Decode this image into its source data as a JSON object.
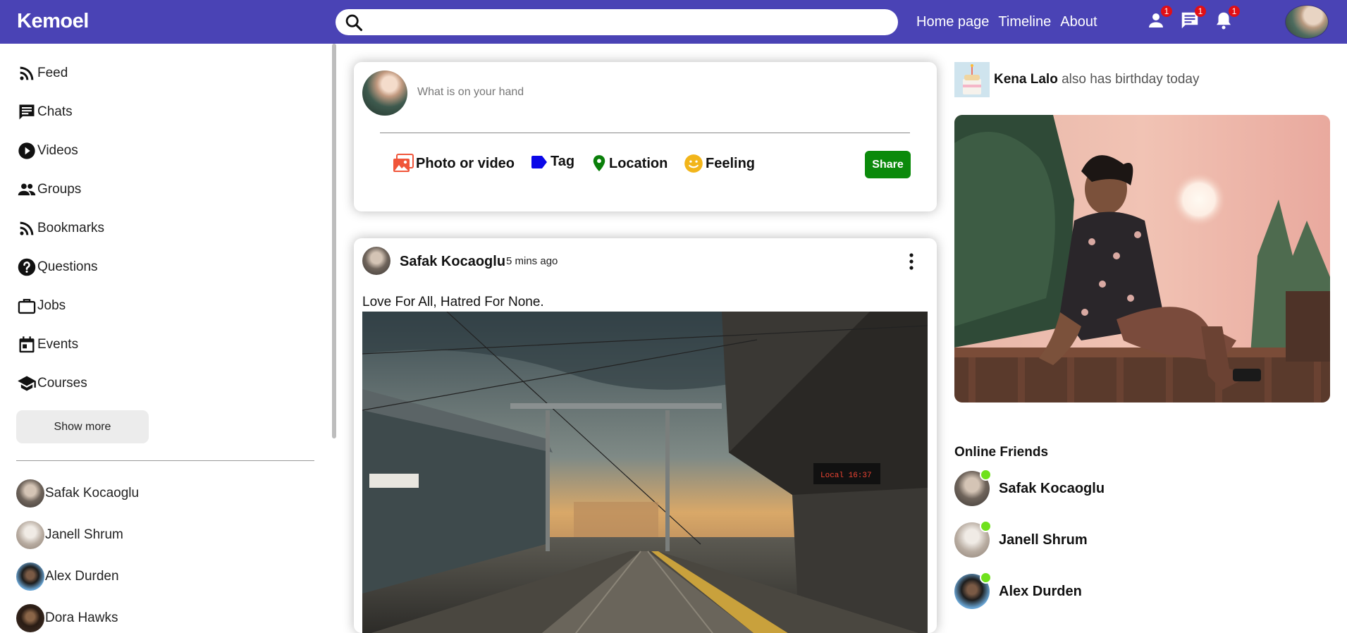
{
  "app": {
    "logo": "Kemoel"
  },
  "topbar": {
    "search_placeholder": "",
    "links": [
      "Home page",
      "Timeline",
      "About"
    ],
    "icons": [
      {
        "name": "person-icon",
        "badge": "1"
      },
      {
        "name": "chat-icon",
        "badge": "1"
      },
      {
        "name": "bell-icon",
        "badge": "1"
      }
    ]
  },
  "sidebar": {
    "items": [
      {
        "label": "Feed",
        "icon": "rss-icon"
      },
      {
        "label": "Chats",
        "icon": "chat-icon"
      },
      {
        "label": "Videos",
        "icon": "play-icon"
      },
      {
        "label": "Groups",
        "icon": "group-icon"
      },
      {
        "label": "Bookmarks",
        "icon": "rss-icon"
      },
      {
        "label": "Questions",
        "icon": "help-icon"
      },
      {
        "label": "Jobs",
        "icon": "briefcase-icon"
      },
      {
        "label": "Events",
        "icon": "calendar-icon"
      },
      {
        "label": "Courses",
        "icon": "school-icon"
      }
    ],
    "show_more": "Show more",
    "friends": [
      "Safak Kocaoglu",
      "Janell Shrum",
      "Alex Durden",
      "Dora Hawks"
    ]
  },
  "share": {
    "placeholder": "What is on your hand",
    "options": [
      {
        "label": "Photo or video",
        "color": "#f0553a"
      },
      {
        "label": "Tag",
        "color": "#0b08e8"
      },
      {
        "label": "Location",
        "color": "#0a7f0a"
      },
      {
        "label": "Feeling",
        "color": "#f2b51a"
      }
    ],
    "button": "Share",
    "button_color": "#0b8a0b"
  },
  "post": {
    "author": "Safak Kocaoglu",
    "time": "5 mins ago",
    "text": "Love For All, Hatred For None."
  },
  "rightbar": {
    "birthday_name": "Kena Lalo",
    "birthday_text": " also has birthday today",
    "online_title": "Online Friends",
    "online": [
      "Safak Kocaoglu",
      "Janell Shrum",
      "Alex Durden"
    ],
    "online_color": "#6fe11c"
  },
  "colors": {
    "topbar": "#4a43b5",
    "badge": "#e20f15"
  }
}
